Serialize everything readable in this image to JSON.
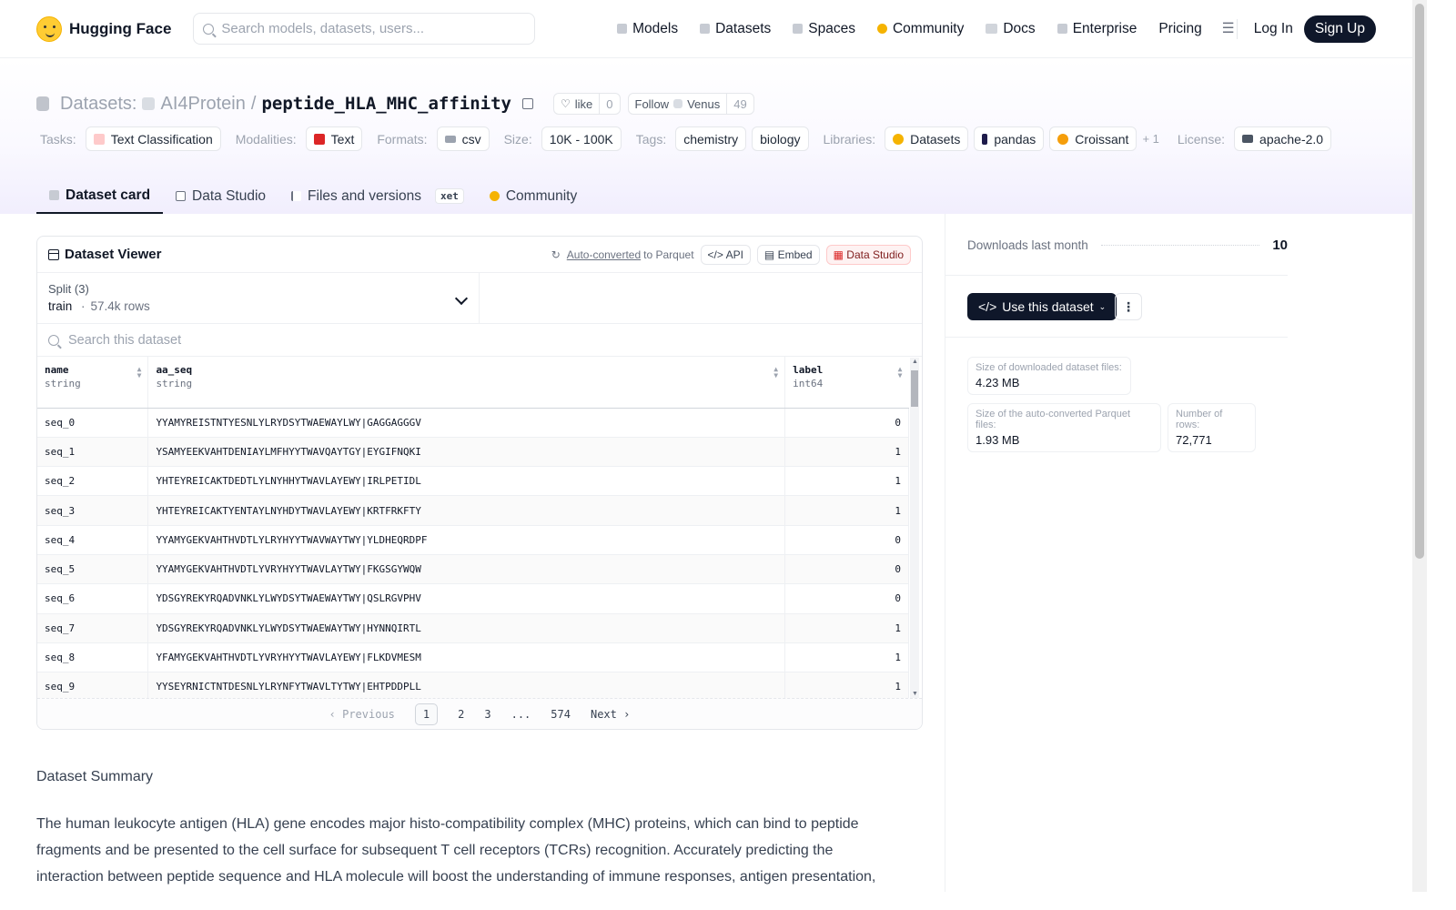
{
  "nav": {
    "brand": "Hugging Face",
    "search_placeholder": "Search models, datasets, users...",
    "links": [
      "Models",
      "Datasets",
      "Spaces",
      "Community",
      "Docs",
      "Enterprise",
      "Pricing"
    ],
    "login": "Log In",
    "signup": "Sign Up"
  },
  "repo": {
    "type_label": "Datasets:",
    "org": "AI4Protein",
    "slash": "/",
    "name": "peptide_HLA_MHC_affinity",
    "like_label": "like",
    "like_count": "0",
    "follow_label": "Follow",
    "follow_org": "Venus",
    "follow_count": "49"
  },
  "tags": {
    "tasks_label": "Tasks:",
    "task": "Text Classification",
    "modalities_label": "Modalities:",
    "modality": "Text",
    "formats_label": "Formats:",
    "format": "csv",
    "size_label": "Size:",
    "size": "10K - 100K",
    "tags_label": "Tags:",
    "tag1": "chemistry",
    "tag2": "biology",
    "libraries_label": "Libraries:",
    "lib1": "Datasets",
    "lib2": "pandas",
    "lib3": "Croissant",
    "lib_more": "+ 1",
    "license_label": "License:",
    "license": "apache-2.0"
  },
  "tabs": {
    "card": "Dataset card",
    "studio": "Data Studio",
    "files": "Files and versions",
    "xet": "xet",
    "community": "Community"
  },
  "viewer": {
    "title": "Dataset Viewer",
    "auto": "Auto-converted",
    "to_parquet": "to Parquet",
    "api": "API",
    "embed": "Embed",
    "studio": "Data Studio",
    "split_label": "Split (3)",
    "split_value": "train",
    "split_dot": "·",
    "split_rows": "57.4k rows",
    "search_placeholder": "Search this dataset",
    "columns": [
      {
        "name": "name",
        "type": "string"
      },
      {
        "name": "aa_seq",
        "type": "string"
      },
      {
        "name": "label",
        "type": "int64"
      }
    ],
    "rows": [
      [
        "seq_0",
        "YYAMYREISTNTYESNLYLRYDSYTWAEWAYLWY|GAGGAGGGV",
        "0"
      ],
      [
        "seq_1",
        "YSAMYEEKVAHTDENIAYLMFHYYTWAVQAYTGY|EYGIFNQKI",
        "1"
      ],
      [
        "seq_2",
        "YHTEYREICAKTDEDTLYLNYHHYTWAVLAYEWY|IRLPETIDL",
        "1"
      ],
      [
        "seq_3",
        "YHTEYREICAKTYENTAYLNYHDYTWAVLAYEWY|KRTFRKFTY",
        "1"
      ],
      [
        "seq_4",
        "YYAMYGEKVAHTHVDTLYLRYHYYTWAVWAYTWY|YLDHEQRDPF",
        "0"
      ],
      [
        "seq_5",
        "YYAMYGEKVAHTHVDTLYVRYHYYTWAVLAYTWY|FKGSGYWQW",
        "0"
      ],
      [
        "seq_6",
        "YDSGYREKYRQADVNKLYLWYDSYTWAEWAYTWY|QSLRGVPHV",
        "0"
      ],
      [
        "seq_7",
        "YDSGYREKYRQADVNKLYLWYDSYTWAEWAYTWY|HYNNQIRTL",
        "1"
      ],
      [
        "seq_8",
        "YFAMYGEKVAHTHVDTLYVRYHYYTWAVLAYEWY|FLKDVMESM",
        "1"
      ],
      [
        "seq_9",
        "YYSEYRNICTNTDESNLYLRYNFYTWAVLTYTWY|EHTPDDPLL",
        "1"
      ]
    ],
    "pager": {
      "prev": "Previous",
      "p1": "1",
      "p2": "2",
      "p3": "3",
      "ellipsis": "...",
      "last": "574",
      "next": "Next"
    }
  },
  "summary": {
    "title": "Dataset Summary",
    "text": "The human leukocyte antigen (HLA) gene encodes major histo-compatibility complex (MHC) proteins, which can bind to peptide fragments and be presented to the cell surface for subsequent T cell receptors (TCRs) recognition. Accurately predicting the interaction between peptide sequence and HLA molecule will boost the understanding of immune responses, antigen presentation,"
  },
  "sidebar": {
    "downloads_label": "Downloads last month",
    "downloads": "10",
    "use_dataset": "Use this dataset",
    "downloaded_size_label": "Size of downloaded dataset files:",
    "downloaded_size": "4.23 MB",
    "parquet_size_label": "Size of the auto-converted Parquet files:",
    "parquet_size": "1.93 MB",
    "rows_label": "Number of rows:",
    "rows": "72,771"
  }
}
